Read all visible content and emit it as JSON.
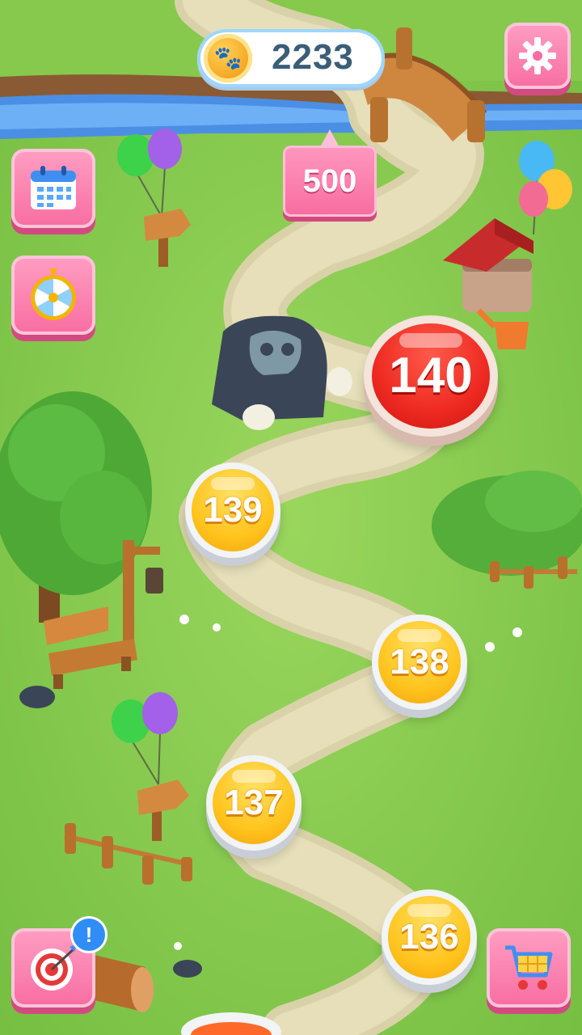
{
  "coins": {
    "icon": "paw-coin-icon",
    "value": "2233"
  },
  "settings": {
    "icon": "gear-icon"
  },
  "reward": {
    "value": "500"
  },
  "side_buttons": [
    {
      "name": "calendar-button",
      "icon": "calendar-icon"
    },
    {
      "name": "lucky-wheel-button",
      "icon": "wheel-icon"
    }
  ],
  "bottom_buttons": {
    "target": {
      "icon": "target-icon",
      "badge": "!"
    },
    "shop": {
      "icon": "shopping-cart-icon"
    }
  },
  "levels": {
    "current": "140",
    "l139": "139",
    "l138": "138",
    "l137": "137",
    "l136": "136"
  },
  "colors": {
    "accent_pink": "#f86da1",
    "level_gold": "#ffc41d",
    "current_red": "#ee2a22",
    "coin_text": "#3b5e78"
  }
}
